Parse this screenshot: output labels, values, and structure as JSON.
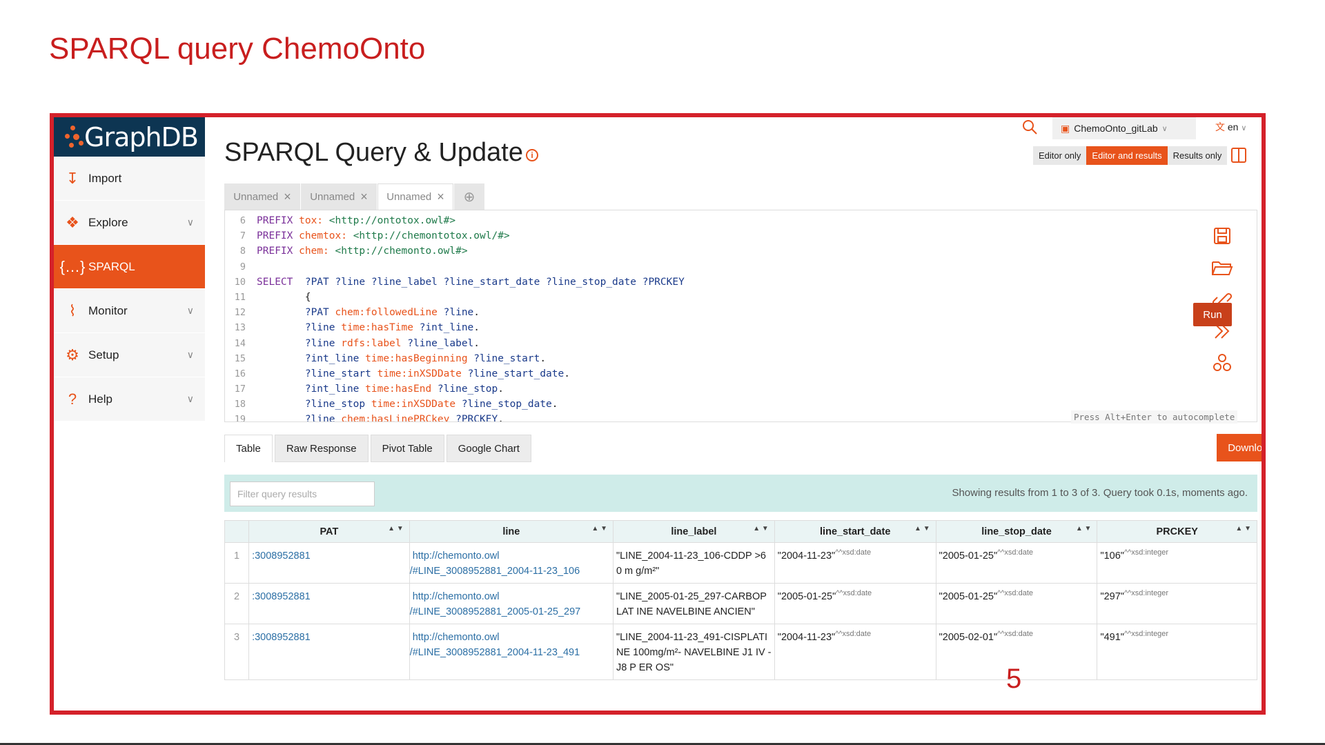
{
  "slide": {
    "title": "SPARQL query ChemoOnto",
    "page_number": "5"
  },
  "app": {
    "brand": "GraphDB"
  },
  "sidebar": {
    "items": [
      {
        "label": "Import",
        "icon": "import-icon",
        "has_chevron": false
      },
      {
        "label": "Explore",
        "icon": "explore-icon",
        "has_chevron": true
      },
      {
        "label": "SPARQL",
        "icon": "sparql-icon",
        "has_chevron": false,
        "active": true
      },
      {
        "label": "Monitor",
        "icon": "monitor-icon",
        "has_chevron": true
      },
      {
        "label": "Setup",
        "icon": "gear-icon",
        "has_chevron": true
      },
      {
        "label": "Help",
        "icon": "help-icon",
        "has_chevron": true
      }
    ]
  },
  "topbar": {
    "repository": "ChemoOnto_gitLab",
    "language": "en"
  },
  "page": {
    "title": "SPARQL Query & Update"
  },
  "view_modes": [
    "Editor only",
    "Editor and results",
    "Results only"
  ],
  "active_view_mode": "Editor and results",
  "query_tabs": [
    "Unnamed",
    "Unnamed",
    "Unnamed"
  ],
  "editor": {
    "lines": [
      {
        "n": "6",
        "parts": [
          [
            "kw",
            "PREFIX "
          ],
          [
            "pf",
            "tox: "
          ],
          [
            "ur",
            "<http://ontotox.owl#>"
          ]
        ]
      },
      {
        "n": "7",
        "parts": [
          [
            "kw",
            "PREFIX "
          ],
          [
            "pf",
            "chemtox: "
          ],
          [
            "ur",
            "<http://chemontotox.owl/#>"
          ]
        ]
      },
      {
        "n": "8",
        "parts": [
          [
            "kw",
            "PREFIX "
          ],
          [
            "pf",
            "chem: "
          ],
          [
            "ur",
            "<http://chemonto.owl#>"
          ]
        ]
      },
      {
        "n": "9",
        "parts": []
      },
      {
        "n": "10",
        "parts": [
          [
            "kw",
            "SELECT  "
          ],
          [
            "vr",
            "?PAT ?line ?line_label ?line_start_date ?line_stop_date ?PRCKEY"
          ]
        ]
      },
      {
        "n": "11",
        "parts": [
          [
            "tx",
            "        {"
          ]
        ]
      },
      {
        "n": "12",
        "parts": [
          [
            "vr",
            "        ?PAT "
          ],
          [
            "pf",
            "chem:followedLine "
          ],
          [
            "vr",
            "?line"
          ],
          [
            "tx",
            "."
          ]
        ]
      },
      {
        "n": "13",
        "parts": [
          [
            "vr",
            "        ?line "
          ],
          [
            "pf",
            "time:hasTime "
          ],
          [
            "vr",
            "?int_line"
          ],
          [
            "tx",
            "."
          ]
        ]
      },
      {
        "n": "14",
        "parts": [
          [
            "vr",
            "        ?line "
          ],
          [
            "pf",
            "rdfs:label "
          ],
          [
            "vr",
            "?line_label"
          ],
          [
            "tx",
            "."
          ]
        ]
      },
      {
        "n": "15",
        "parts": [
          [
            "vr",
            "        ?int_line "
          ],
          [
            "pf",
            "time:hasBeginning "
          ],
          [
            "vr",
            "?line_start"
          ],
          [
            "tx",
            "."
          ]
        ]
      },
      {
        "n": "16",
        "parts": [
          [
            "vr",
            "        ?line_start "
          ],
          [
            "pf",
            "time:inXSDDate "
          ],
          [
            "vr",
            "?line_start_date"
          ],
          [
            "tx",
            "."
          ]
        ]
      },
      {
        "n": "17",
        "parts": [
          [
            "vr",
            "        ?int_line "
          ],
          [
            "pf",
            "time:hasEnd "
          ],
          [
            "vr",
            "?line_stop"
          ],
          [
            "tx",
            "."
          ]
        ]
      },
      {
        "n": "18",
        "parts": [
          [
            "vr",
            "        ?line_stop "
          ],
          [
            "pf",
            "time:inXSDDate "
          ],
          [
            "vr",
            "?line_stop_date"
          ],
          [
            "tx",
            "."
          ]
        ]
      },
      {
        "n": "19",
        "parts": [
          [
            "vr",
            "        ?line "
          ],
          [
            "pf",
            "chem:hasLinePRCkey "
          ],
          [
            "vr",
            "?PRCKEY"
          ],
          [
            "tx",
            "."
          ]
        ]
      }
    ],
    "run_label": "Run",
    "hint": "Press Alt+Enter to autocomplete"
  },
  "result_tabs": [
    "Table",
    "Raw Response",
    "Pivot Table",
    "Google Chart"
  ],
  "download_label": "Download as",
  "filter_placeholder": "Filter query results",
  "results_info": "Showing results from 1 to 3 of 3. Query took 0.1s, moments ago.",
  "table": {
    "columns": [
      "PAT",
      "line",
      "line_label",
      "line_start_date",
      "line_stop_date",
      "PRCKEY"
    ],
    "rows": [
      {
        "idx": "1",
        "pat": ":3008952881",
        "line1": "http://chemonto.owl",
        "line2": "/#LINE_3008952881_2004-11-23_106",
        "label": "\"LINE_2004-11-23_106-CDDP >60 m g/m²\"",
        "start": "\"2004-11-23\"",
        "stop": "\"2005-01-25\"",
        "prc": "\"106\"",
        "date_type": "^^xsd:date",
        "int_type": "^^xsd:integer"
      },
      {
        "idx": "2",
        "pat": ":3008952881",
        "line1": "http://chemonto.owl",
        "line2": "/#LINE_3008952881_2005-01-25_297",
        "label": "\"LINE_2005-01-25_297-CARBOPLAT INE NAVELBINE ANCIEN\"",
        "start": "\"2005-01-25\"",
        "stop": "\"2005-01-25\"",
        "prc": "\"297\"",
        "date_type": "^^xsd:date",
        "int_type": "^^xsd:integer"
      },
      {
        "idx": "3",
        "pat": ":3008952881",
        "line1": "http://chemonto.owl",
        "line2": "/#LINE_3008952881_2004-11-23_491",
        "label": "\"LINE_2004-11-23_491-CISPLATINE 100mg/m²- NAVELBINE J1 IV - J8 P ER OS\"",
        "start": "\"2004-11-23\"",
        "stop": "\"2005-02-01\"",
        "prc": "\"491\"",
        "date_type": "^^xsd:date",
        "int_type": "^^xsd:integer"
      }
    ]
  },
  "colors": {
    "accent": "#e8531b",
    "brand_bg": "#0d3552",
    "frame": "#d4212a",
    "title": "#c81e1e"
  }
}
